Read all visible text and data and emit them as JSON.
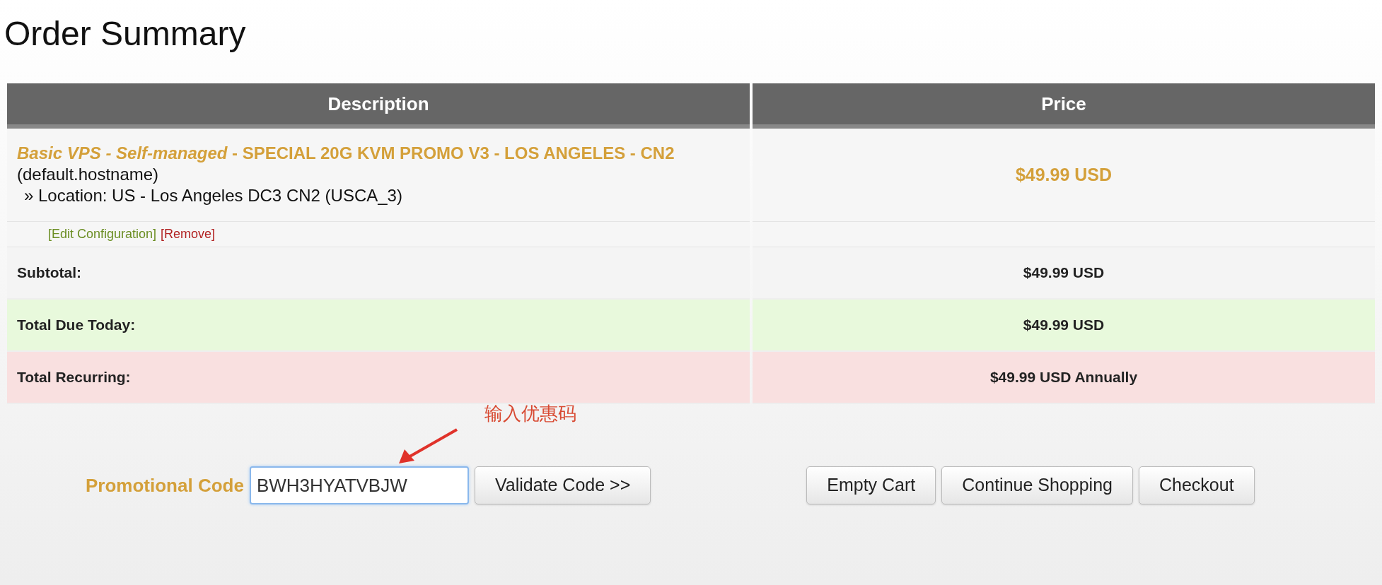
{
  "title": "Order Summary",
  "table": {
    "columns": [
      "Description",
      "Price"
    ],
    "item": {
      "name": "Basic VPS - Self-managed",
      "plan": " - SPECIAL 20G KVM PROMO V3 - LOS ANGELES - CN2",
      "hostname": "(default.hostname)",
      "option": "» Location: US - Los Angeles DC3 CN2 (USCA_3)",
      "price": "$49.99 USD",
      "edit_link": "[Edit Configuration]",
      "remove_link": "[Remove]"
    },
    "totals": [
      {
        "kind": "subtotal",
        "label": "Subtotal:",
        "value": "$49.99 USD"
      },
      {
        "kind": "due",
        "label": "Total Due Today:",
        "value": "$49.99 USD"
      },
      {
        "kind": "recurring",
        "label": "Total Recurring:",
        "value": "$49.99 USD Annually"
      }
    ]
  },
  "promo": {
    "label": "Promotional Code",
    "value": "BWH3HYATVBJW",
    "button": "Validate Code >>"
  },
  "annotation": "输入优惠码",
  "buttons": [
    "Empty Cart",
    "Continue Shopping",
    "Checkout"
  ]
}
